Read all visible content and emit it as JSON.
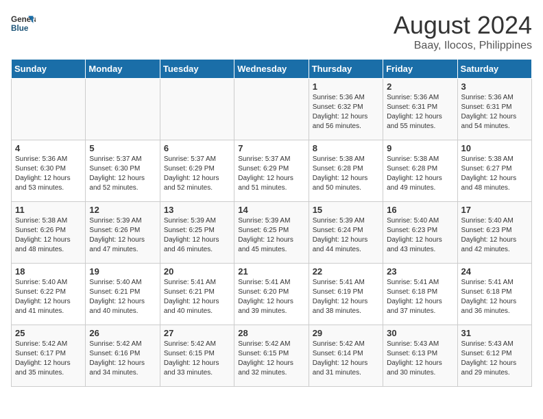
{
  "header": {
    "logo_general": "General",
    "logo_blue": "Blue",
    "month_year": "August 2024",
    "location": "Baay, Ilocos, Philippines"
  },
  "weekdays": [
    "Sunday",
    "Monday",
    "Tuesday",
    "Wednesday",
    "Thursday",
    "Friday",
    "Saturday"
  ],
  "weeks": [
    [
      {
        "day": "",
        "sunrise": "",
        "sunset": "",
        "daylight": ""
      },
      {
        "day": "",
        "sunrise": "",
        "sunset": "",
        "daylight": ""
      },
      {
        "day": "",
        "sunrise": "",
        "sunset": "",
        "daylight": ""
      },
      {
        "day": "",
        "sunrise": "",
        "sunset": "",
        "daylight": ""
      },
      {
        "day": "1",
        "sunrise": "5:36 AM",
        "sunset": "6:32 PM",
        "daylight": "12 hours and 56 minutes."
      },
      {
        "day": "2",
        "sunrise": "5:36 AM",
        "sunset": "6:31 PM",
        "daylight": "12 hours and 55 minutes."
      },
      {
        "day": "3",
        "sunrise": "5:36 AM",
        "sunset": "6:31 PM",
        "daylight": "12 hours and 54 minutes."
      }
    ],
    [
      {
        "day": "4",
        "sunrise": "5:36 AM",
        "sunset": "6:30 PM",
        "daylight": "12 hours and 53 minutes."
      },
      {
        "day": "5",
        "sunrise": "5:37 AM",
        "sunset": "6:30 PM",
        "daylight": "12 hours and 52 minutes."
      },
      {
        "day": "6",
        "sunrise": "5:37 AM",
        "sunset": "6:29 PM",
        "daylight": "12 hours and 52 minutes."
      },
      {
        "day": "7",
        "sunrise": "5:37 AM",
        "sunset": "6:29 PM",
        "daylight": "12 hours and 51 minutes."
      },
      {
        "day": "8",
        "sunrise": "5:38 AM",
        "sunset": "6:28 PM",
        "daylight": "12 hours and 50 minutes."
      },
      {
        "day": "9",
        "sunrise": "5:38 AM",
        "sunset": "6:28 PM",
        "daylight": "12 hours and 49 minutes."
      },
      {
        "day": "10",
        "sunrise": "5:38 AM",
        "sunset": "6:27 PM",
        "daylight": "12 hours and 48 minutes."
      }
    ],
    [
      {
        "day": "11",
        "sunrise": "5:38 AM",
        "sunset": "6:26 PM",
        "daylight": "12 hours and 48 minutes."
      },
      {
        "day": "12",
        "sunrise": "5:39 AM",
        "sunset": "6:26 PM",
        "daylight": "12 hours and 47 minutes."
      },
      {
        "day": "13",
        "sunrise": "5:39 AM",
        "sunset": "6:25 PM",
        "daylight": "12 hours and 46 minutes."
      },
      {
        "day": "14",
        "sunrise": "5:39 AM",
        "sunset": "6:25 PM",
        "daylight": "12 hours and 45 minutes."
      },
      {
        "day": "15",
        "sunrise": "5:39 AM",
        "sunset": "6:24 PM",
        "daylight": "12 hours and 44 minutes."
      },
      {
        "day": "16",
        "sunrise": "5:40 AM",
        "sunset": "6:23 PM",
        "daylight": "12 hours and 43 minutes."
      },
      {
        "day": "17",
        "sunrise": "5:40 AM",
        "sunset": "6:23 PM",
        "daylight": "12 hours and 42 minutes."
      }
    ],
    [
      {
        "day": "18",
        "sunrise": "5:40 AM",
        "sunset": "6:22 PM",
        "daylight": "12 hours and 41 minutes."
      },
      {
        "day": "19",
        "sunrise": "5:40 AM",
        "sunset": "6:21 PM",
        "daylight": "12 hours and 40 minutes."
      },
      {
        "day": "20",
        "sunrise": "5:41 AM",
        "sunset": "6:21 PM",
        "daylight": "12 hours and 40 minutes."
      },
      {
        "day": "21",
        "sunrise": "5:41 AM",
        "sunset": "6:20 PM",
        "daylight": "12 hours and 39 minutes."
      },
      {
        "day": "22",
        "sunrise": "5:41 AM",
        "sunset": "6:19 PM",
        "daylight": "12 hours and 38 minutes."
      },
      {
        "day": "23",
        "sunrise": "5:41 AM",
        "sunset": "6:18 PM",
        "daylight": "12 hours and 37 minutes."
      },
      {
        "day": "24",
        "sunrise": "5:41 AM",
        "sunset": "6:18 PM",
        "daylight": "12 hours and 36 minutes."
      }
    ],
    [
      {
        "day": "25",
        "sunrise": "5:42 AM",
        "sunset": "6:17 PM",
        "daylight": "12 hours and 35 minutes."
      },
      {
        "day": "26",
        "sunrise": "5:42 AM",
        "sunset": "6:16 PM",
        "daylight": "12 hours and 34 minutes."
      },
      {
        "day": "27",
        "sunrise": "5:42 AM",
        "sunset": "6:15 PM",
        "daylight": "12 hours and 33 minutes."
      },
      {
        "day": "28",
        "sunrise": "5:42 AM",
        "sunset": "6:15 PM",
        "daylight": "12 hours and 32 minutes."
      },
      {
        "day": "29",
        "sunrise": "5:42 AM",
        "sunset": "6:14 PM",
        "daylight": "12 hours and 31 minutes."
      },
      {
        "day": "30",
        "sunrise": "5:43 AM",
        "sunset": "6:13 PM",
        "daylight": "12 hours and 30 minutes."
      },
      {
        "day": "31",
        "sunrise": "5:43 AM",
        "sunset": "6:12 PM",
        "daylight": "12 hours and 29 minutes."
      }
    ]
  ]
}
